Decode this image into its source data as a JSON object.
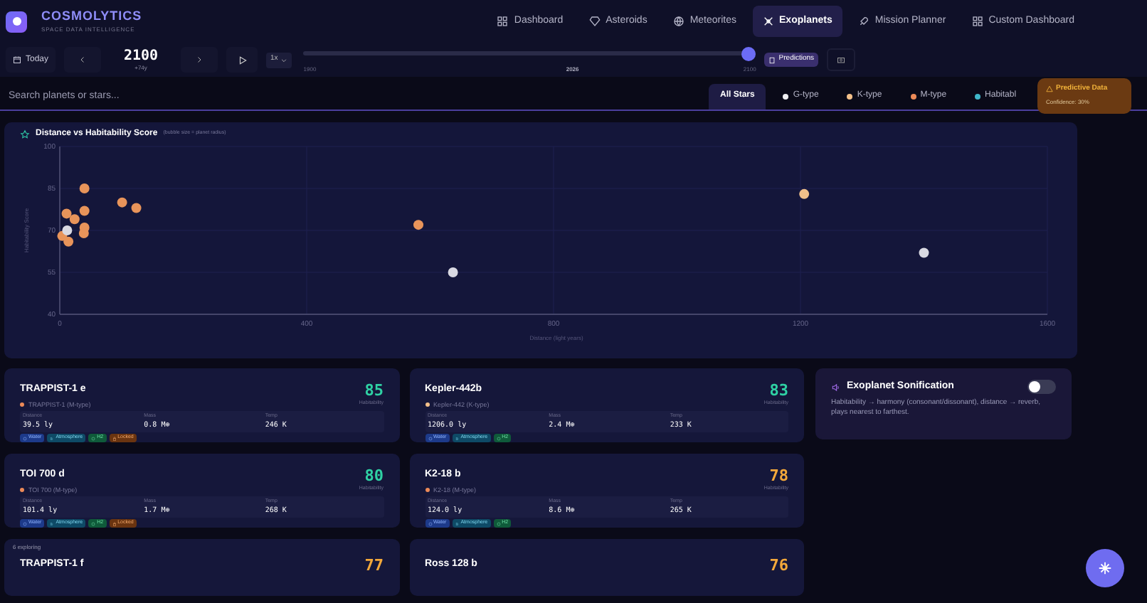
{
  "brand": {
    "name": "COSMOLYTICS",
    "tagline": "SPACE DATA INTELLIGENCE"
  },
  "nav": [
    {
      "label": "Dashboard",
      "selected": false
    },
    {
      "label": "Asteroids",
      "selected": false
    },
    {
      "label": "Meteorites",
      "selected": false
    },
    {
      "label": "Exoplanets",
      "selected": true
    },
    {
      "label": "Mission Planner",
      "selected": false
    },
    {
      "label": "Custom Dashboard",
      "selected": false
    }
  ],
  "timeline": {
    "today": "Today",
    "year": "2100",
    "offset": "+74y",
    "speed": "1x",
    "start": "1900",
    "mid": "2026",
    "end": "2100",
    "level": 1.0,
    "predictions": {
      "label": "Predictions",
      "selected": true
    }
  },
  "search": {
    "placeholder": "Search planets or stars..."
  },
  "filters": [
    {
      "label": "All Stars",
      "selected": true
    },
    {
      "label": "G-type",
      "selected": false,
      "color": "#f1f1f4"
    },
    {
      "label": "K-type",
      "selected": false,
      "color": "#f3c08a"
    },
    {
      "label": "M-type",
      "selected": false,
      "color": "#ec8a58"
    },
    {
      "label": "Habitabl",
      "selected": false,
      "color": "#3fb6c9"
    }
  ],
  "prediction_badge": {
    "title": "Predictive Data",
    "confidence": "Confidence: 30%"
  },
  "chart": {
    "title": "Distance vs Habitability Score",
    "subtitle": "(bubble size = planet radius)",
    "chart_data": {
      "type": "scatter",
      "grid": true,
      "xlabel": "Distance (light years)",
      "ylabel": "Habitability Score",
      "xlim": [
        0,
        1600
      ],
      "ylim": [
        40,
        100
      ],
      "xticks": [
        0,
        400,
        800,
        1200,
        1600
      ],
      "yticks": [
        40,
        55,
        70,
        85,
        100
      ],
      "series": [
        {
          "color": "#e8945a",
          "x": [
            40,
            11,
            24,
            40,
            40,
            39,
            4,
            14,
            101,
            124,
            581
          ],
          "values": [
            85,
            76,
            74,
            77,
            71,
            69,
            68,
            66,
            80,
            78,
            72
          ]
        },
        {
          "color": "#f0c08a",
          "x": [
            1206
          ],
          "values": [
            83
          ]
        },
        {
          "color": "#d9d9e2",
          "x": [
            12,
            637,
            1400
          ],
          "values": [
            70,
            55,
            62
          ]
        }
      ]
    }
  },
  "note": "6 exploring",
  "planets": [
    {
      "name": "TRAPPIST-1 e",
      "star": "TRAPPIST-1 (M-type)",
      "color": "#ec8a58",
      "stats": [
        {
          "label": "Distance",
          "value": "39.5 ly"
        },
        {
          "label": "Mass",
          "value": "0.8 M⊕"
        },
        {
          "label": "Temp",
          "value": "246 K"
        }
      ],
      "score": "85",
      "score_label": "Habitability",
      "tags": [
        {
          "kind": "water",
          "label": "Water"
        },
        {
          "kind": "atmosphere",
          "label": "Atmosphere"
        },
        {
          "kind": "h2",
          "label": "H2"
        },
        {
          "kind": "locked",
          "label": "Locked"
        }
      ]
    },
    {
      "name": "Kepler-442b",
      "star": "Kepler-442 (K-type)",
      "color": "#f3c08a",
      "stats": [
        {
          "label": "Distance",
          "value": "1206.0 ly"
        },
        {
          "label": "Mass",
          "value": "2.4 M⊕"
        },
        {
          "label": "Temp",
          "value": "233 K"
        }
      ],
      "score": "83",
      "score_label": "Habitability",
      "tags": [
        {
          "kind": "water",
          "label": "Water"
        },
        {
          "kind": "atmosphere",
          "label": "Atmosphere"
        },
        {
          "kind": "h2",
          "label": "H2"
        }
      ]
    },
    {
      "name": "TOI 700 d",
      "star": "TOI 700 (M-type)",
      "color": "#ec8a58",
      "stats": [
        {
          "label": "Distance",
          "value": "101.4 ly"
        },
        {
          "label": "Mass",
          "value": "1.7 M⊕"
        },
        {
          "label": "Temp",
          "value": "268 K"
        }
      ],
      "score": "80",
      "score_label": "Habitability",
      "tags": [
        {
          "kind": "water",
          "label": "Water"
        },
        {
          "kind": "atmosphere",
          "label": "Atmosphere"
        },
        {
          "kind": "h2",
          "label": "H2"
        },
        {
          "kind": "locked",
          "label": "Locked"
        }
      ]
    },
    {
      "name": "K2-18 b",
      "star": "K2-18 (M-type)",
      "color": "#ec8a58",
      "stats": [
        {
          "label": "Distance",
          "value": "124.0 ly"
        },
        {
          "label": "Mass",
          "value": "8.6 M⊕"
        },
        {
          "label": "Temp",
          "value": "265 K"
        }
      ],
      "score": "78",
      "score_label": "Habitability",
      "tags": [
        {
          "kind": "water",
          "label": "Water"
        },
        {
          "kind": "atmosphere",
          "label": "Atmosphere"
        },
        {
          "kind": "h2",
          "label": "H2"
        }
      ]
    },
    {
      "name": "TRAPPIST-1 f",
      "score": "77"
    },
    {
      "name": "Ross 128 b",
      "score": "76"
    }
  ],
  "sonification": {
    "title": "Exoplanet Sonification",
    "on": false,
    "description": "Habitability → harmony (consonant/dissonant), distance → reverb, plays nearest to farthest."
  }
}
